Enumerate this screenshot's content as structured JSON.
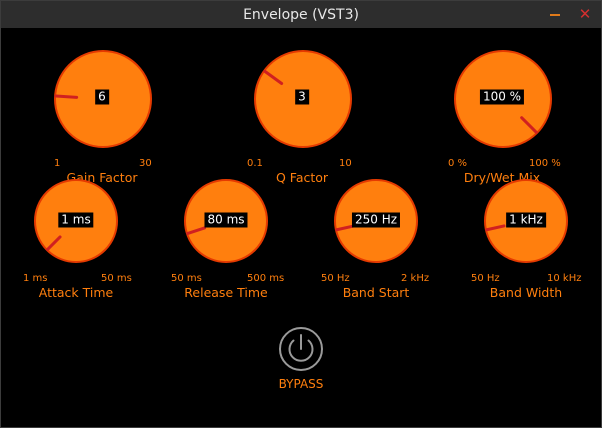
{
  "window": {
    "title": "Envelope (VST3)",
    "minimize_icon": "minimize-icon",
    "close_icon": "close-icon",
    "close_color": "#d32f2f",
    "minimize_color": "#e07a1a"
  },
  "theme": {
    "knob_fill": "#ff7f0e",
    "knob_stroke": "#e53a00",
    "indicator": "#d02020",
    "label_color": "#ff7f0e",
    "bypass_color": "#9a9a9a"
  },
  "knobs": [
    {
      "id": "gain-factor",
      "label": "Gain Factor",
      "value": "6",
      "min": "1",
      "max": "30",
      "position": 0.18
    },
    {
      "id": "q-factor",
      "label": "Q Factor",
      "value": "3",
      "min": "0.1",
      "max": "10",
      "position": 0.3
    },
    {
      "id": "dry-wet-mix",
      "label": "Dry/Wet Mix",
      "value": "100 %",
      "min": "0 %",
      "max": "100 %",
      "position": 1.0
    },
    {
      "id": "attack-time",
      "label": "Attack Time",
      "value": "1 ms",
      "min": "1 ms",
      "max": "50 ms",
      "position": 0.0
    },
    {
      "id": "release-time",
      "label": "Release Time",
      "value": "80 ms",
      "min": "50 ms",
      "max": "500 ms",
      "position": 0.1
    },
    {
      "id": "band-start",
      "label": "Band Start",
      "value": "250 Hz",
      "min": "50 Hz",
      "max": "2 kHz",
      "position": 0.12
    },
    {
      "id": "band-width",
      "label": "Band Width",
      "value": "1 kHz",
      "min": "50 Hz",
      "max": "10 kHz",
      "position": 0.12
    }
  ],
  "bypass": {
    "label": "BYPASS",
    "icon": "power-icon",
    "active": false
  }
}
